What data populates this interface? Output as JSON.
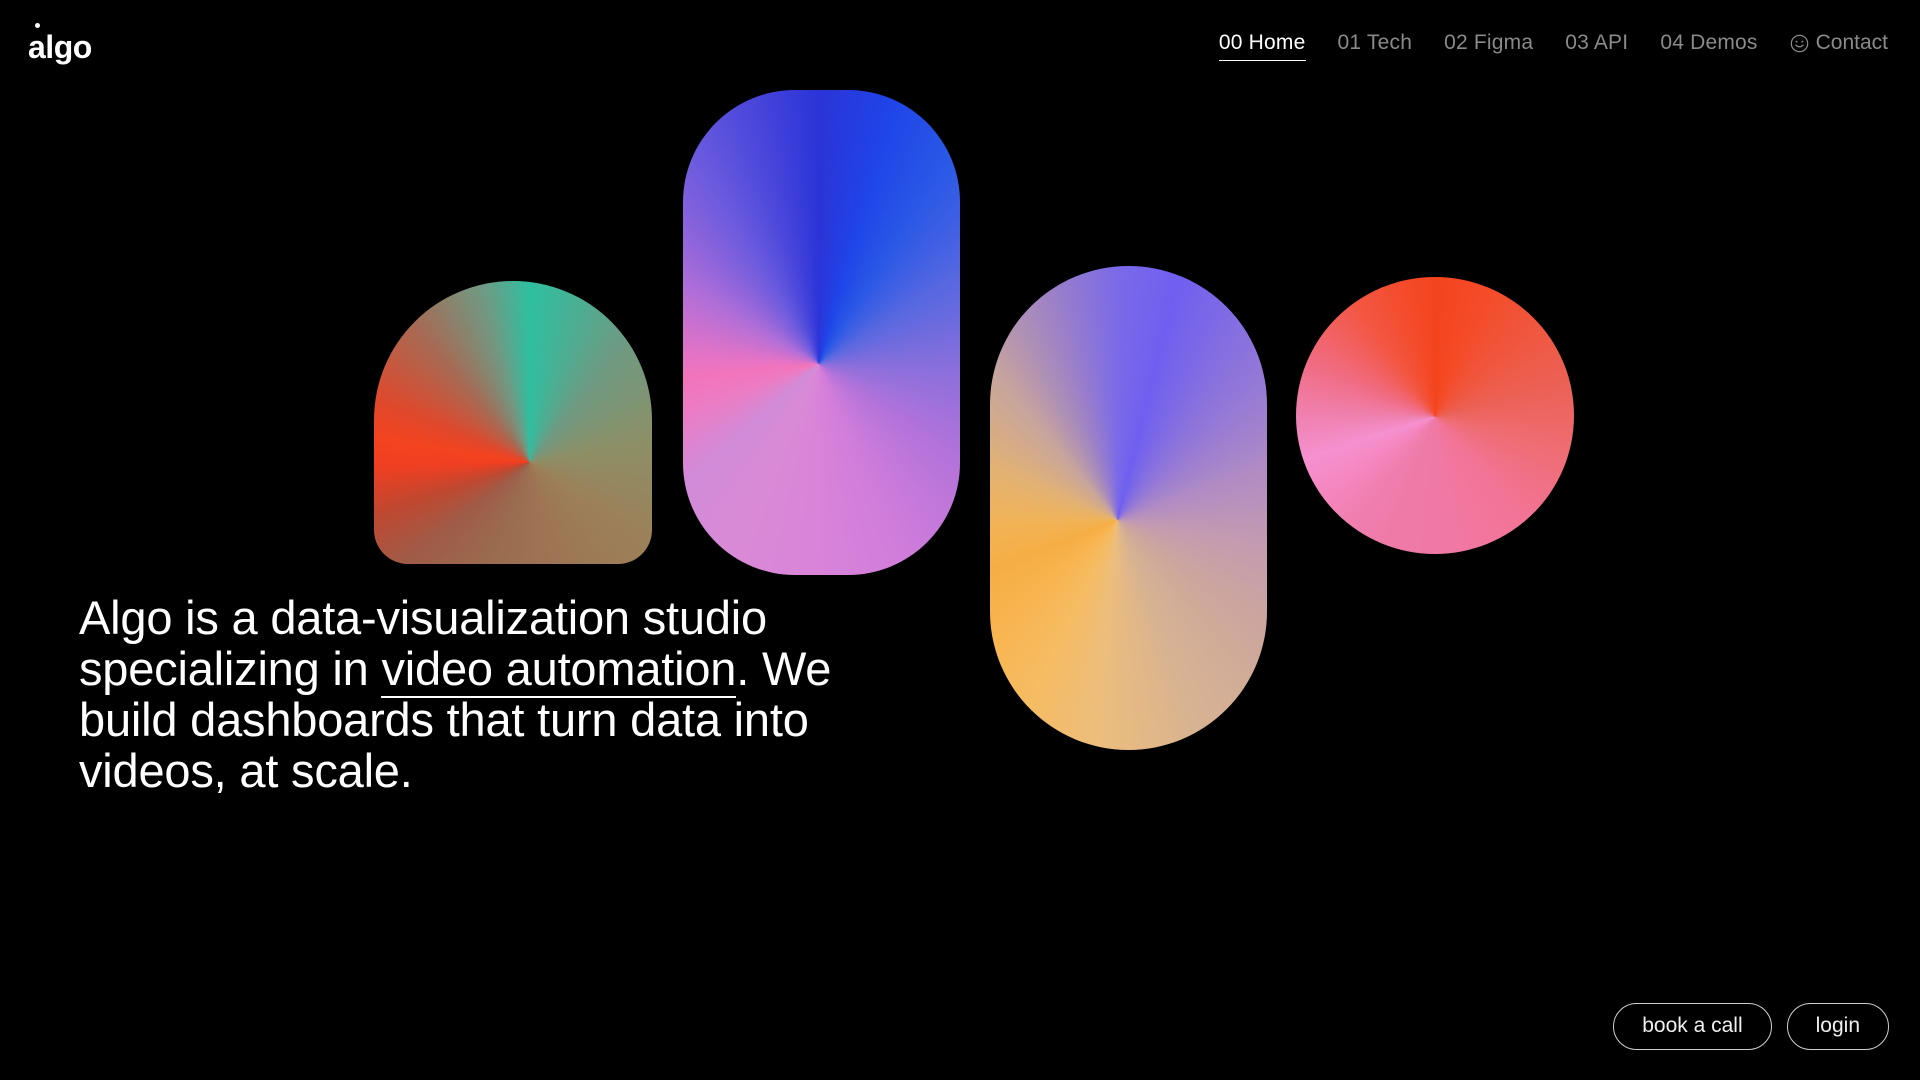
{
  "brand": {
    "logo_text": "algo",
    "logo_mark": "dot-over-a"
  },
  "nav": {
    "items": [
      {
        "label": "00 Home",
        "active": true
      },
      {
        "label": "01 Tech",
        "active": false
      },
      {
        "label": "02 Figma",
        "active": false
      },
      {
        "label": "03 API",
        "active": false
      },
      {
        "label": "04 Demos",
        "active": false
      }
    ],
    "contact": {
      "label": "Contact",
      "icon": "smiley-face-icon"
    }
  },
  "hero": {
    "headline_part1": "Algo is a data-visualization studio specializing in ",
    "headline_link": "video automation",
    "headline_part2": ". We build dashboards that turn data into videos, at scale."
  },
  "shapes": [
    {
      "name": "arch",
      "form": "arch-rounded-top",
      "colors": [
        "#2fbfa0",
        "#9e7353",
        "#f4431f"
      ]
    },
    {
      "name": "tall-rounded-rect",
      "form": "rounded-rectangle",
      "colors": [
        "#1f45e8",
        "#b473da",
        "#f274bb"
      ]
    },
    {
      "name": "capsule",
      "form": "capsule",
      "colors": [
        "#6f5ff0",
        "#cda79c",
        "#f8b44f"
      ]
    },
    {
      "name": "circle",
      "form": "circle",
      "colors": [
        "#f4441c",
        "#ef78a6",
        "#f690cf"
      ]
    }
  ],
  "footer": {
    "book_call_label": "book a call",
    "login_label": "login"
  },
  "theme": {
    "background": "#000000",
    "text": "#ffffff",
    "nav_inactive": "#8a8a8a",
    "border": "#cfcfcf"
  }
}
